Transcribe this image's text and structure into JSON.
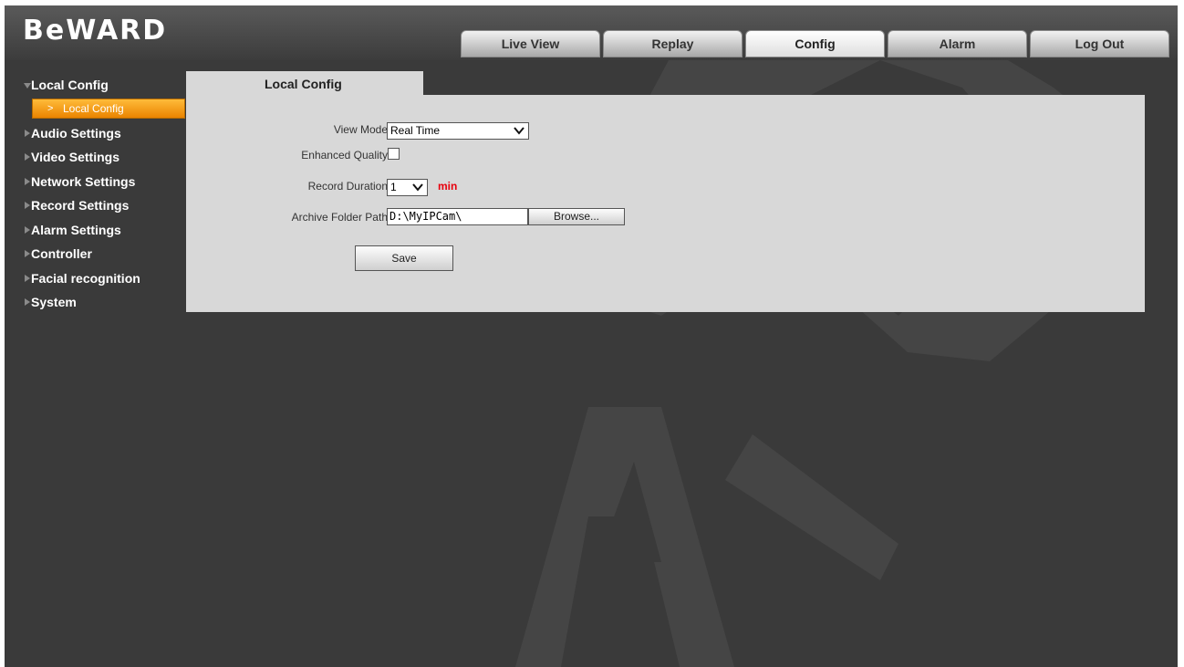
{
  "header": {
    "logo": "BeWARD",
    "tabs": [
      {
        "label": "Live View"
      },
      {
        "label": "Replay"
      },
      {
        "label": "Config"
      },
      {
        "label": "Alarm"
      },
      {
        "label": "Log Out"
      }
    ],
    "active_tab": "Config"
  },
  "sidebar": {
    "expanded_group": {
      "label": "Local Config",
      "sub_item": "Local Config"
    },
    "items": [
      {
        "label": "Audio Settings"
      },
      {
        "label": "Video Settings"
      },
      {
        "label": "Network Settings"
      },
      {
        "label": "Record Settings"
      },
      {
        "label": "Alarm Settings"
      },
      {
        "label": "Controller"
      },
      {
        "label": "Facial recognition"
      },
      {
        "label": "System"
      }
    ]
  },
  "content": {
    "tab_title": "Local Config",
    "view_mode": {
      "label": "View Mode",
      "value": "Real Time"
    },
    "enhanced_quality": {
      "label": "Enhanced Quality",
      "checked": false
    },
    "record_duration": {
      "label": "Record Duration",
      "value": "1",
      "unit": "min"
    },
    "archive_path": {
      "label": "Archive Folder Path",
      "value": "D:\\MyIPCam\\",
      "browse_label": "Browse..."
    },
    "save_label": "Save"
  },
  "colors": {
    "background": "#3a3a3a",
    "panel": "#d8d8d8",
    "accent": "#f39200",
    "unit_text": "#e8000d",
    "watermark": "#454545"
  }
}
